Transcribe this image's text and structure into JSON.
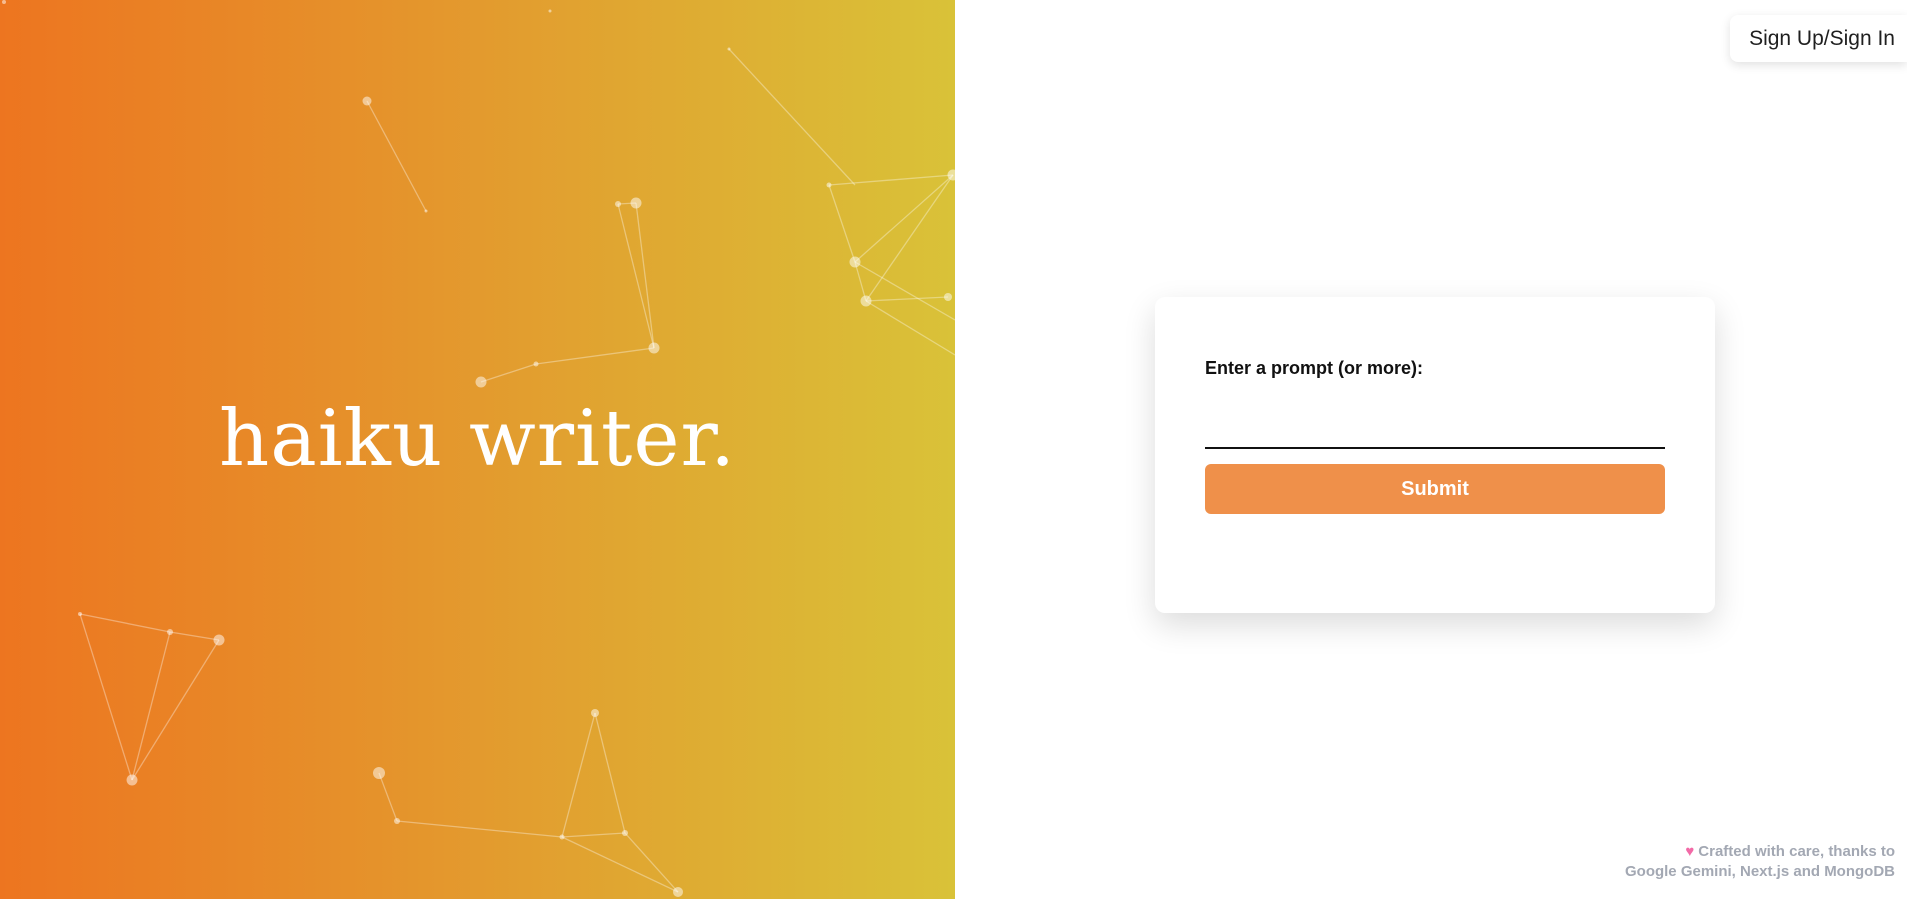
{
  "hero": {
    "title": "haiku writer."
  },
  "header": {
    "auth_label": "Sign Up/Sign In"
  },
  "form": {
    "label": "Enter a prompt (or more):",
    "input_value": "",
    "input_placeholder": "",
    "submit_label": "Submit"
  },
  "footer": {
    "heart_icon": "heart-icon",
    "line1": "Crafted with care, thanks to",
    "line2": "Google Gemini, Next.js and MongoDB"
  },
  "colors": {
    "gradient_start": "#ed7520",
    "gradient_end": "#d9c238",
    "submit": "#ef904a",
    "heart": "#f26aa7"
  }
}
